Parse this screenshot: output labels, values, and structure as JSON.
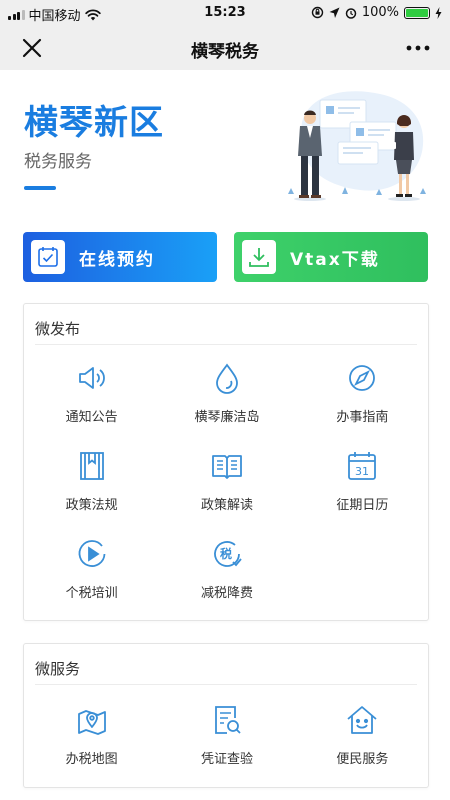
{
  "status_bar": {
    "carrier": "中国移动",
    "time": "15:23",
    "battery": "100%"
  },
  "navbar": {
    "title": "横琴税务"
  },
  "hero": {
    "title": "横琴新区",
    "subtitle": "税务服务"
  },
  "actions": [
    {
      "label": "在线预约",
      "icon": "calendar-check-icon"
    },
    {
      "label": "Vtax下载",
      "icon": "download-icon"
    }
  ],
  "micro_publish": {
    "title": "微发布",
    "items": [
      {
        "label": "通知公告",
        "icon": "speaker-icon"
      },
      {
        "label": "横琴廉洁岛",
        "icon": "water-drop-icon"
      },
      {
        "label": "办事指南",
        "icon": "compass-icon"
      },
      {
        "label": "政策法规",
        "icon": "book-icon"
      },
      {
        "label": "政策解读",
        "icon": "open-book-icon"
      },
      {
        "label": "征期日历",
        "icon": "calendar-icon"
      },
      {
        "label": "个税培训",
        "icon": "play-icon"
      },
      {
        "label": "减税降费",
        "icon": "tax-reduction-icon"
      }
    ]
  },
  "micro_service": {
    "title": "微服务",
    "items": [
      {
        "label": "办税地图",
        "icon": "map-icon"
      },
      {
        "label": "凭证查验",
        "icon": "document-search-icon"
      },
      {
        "label": "便民服务",
        "icon": "house-smile-icon"
      }
    ]
  },
  "colors": {
    "accent": "#1a7de0",
    "icon": "#3a8fd6",
    "green": "#3ed16a"
  },
  "calendar_day": "31",
  "tax_glyph": "税"
}
